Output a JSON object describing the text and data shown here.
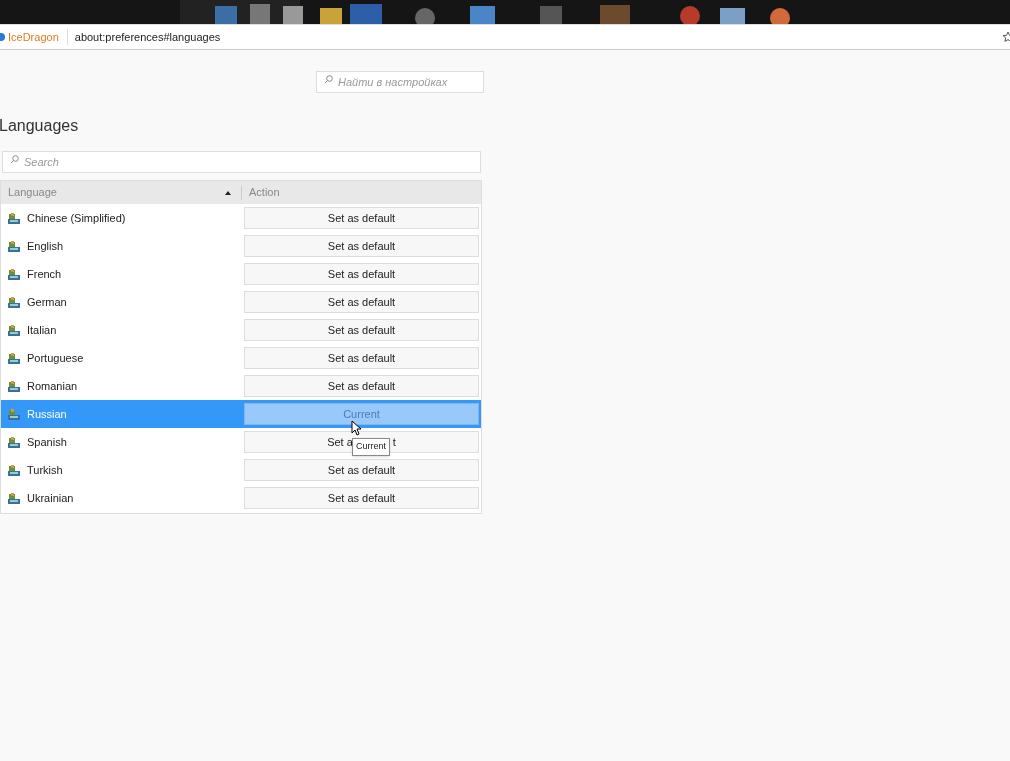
{
  "browser": {
    "identity": "IceDragon",
    "url": "about:preferences#languages"
  },
  "settings_search": {
    "placeholder": "Найти в настройках"
  },
  "heading": "Languages",
  "search": {
    "placeholder": "Search"
  },
  "table": {
    "columns": [
      {
        "label": "Language",
        "sorted": true
      },
      {
        "label": "Action",
        "sorted": false
      }
    ],
    "rows": [
      {
        "language": "Chinese (Simplified)",
        "action": "Set as default",
        "selected": false
      },
      {
        "language": "English",
        "action": "Set as default",
        "selected": false
      },
      {
        "language": "French",
        "action": "Set as default",
        "selected": false
      },
      {
        "language": "German",
        "action": "Set as default",
        "selected": false
      },
      {
        "language": "Italian",
        "action": "Set as default",
        "selected": false
      },
      {
        "language": "Portuguese",
        "action": "Set as default",
        "selected": false
      },
      {
        "language": "Romanian",
        "action": "Set as default",
        "selected": false
      },
      {
        "language": "Russian",
        "action": "Current",
        "selected": true
      },
      {
        "language": "Spanish",
        "action": "Set a",
        "action_tail": "t",
        "selected": false
      },
      {
        "language": "Turkish",
        "action": "Set as default",
        "selected": false
      },
      {
        "language": "Ukrainian",
        "action": "Set as default",
        "selected": false
      }
    ]
  },
  "tooltip": "Current"
}
